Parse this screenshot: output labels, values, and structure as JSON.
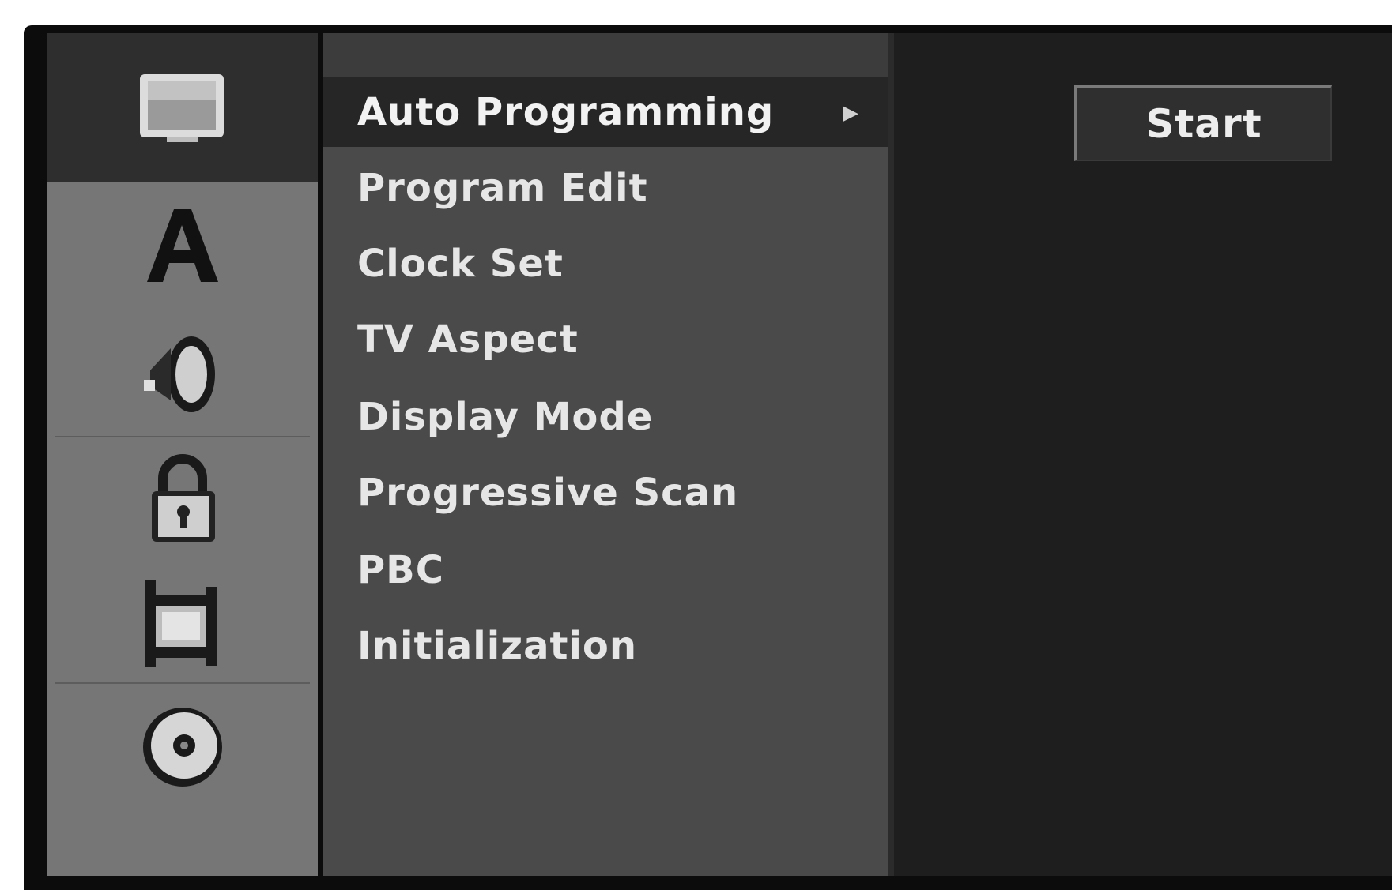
{
  "sidebar": {
    "tabs": [
      {
        "icon": "tv-screen-icon",
        "selected": true
      },
      {
        "icon": "letter-a-language-icon",
        "selected": false
      },
      {
        "icon": "speaker-audio-icon",
        "selected": false
      },
      {
        "icon": "padlock-icon",
        "selected": false
      },
      {
        "icon": "film-strip-icon",
        "selected": false
      },
      {
        "icon": "disc-icon",
        "selected": false
      }
    ]
  },
  "menu": {
    "items": [
      {
        "label": "Auto Programming",
        "selected": true,
        "arrow": "▶"
      },
      {
        "label": "Program Edit"
      },
      {
        "label": "Clock Set"
      },
      {
        "label": "TV Aspect"
      },
      {
        "label": "Display Mode"
      },
      {
        "label": "Progressive Scan"
      },
      {
        "label": "PBC"
      },
      {
        "label": "Initialization"
      }
    ]
  },
  "option_panel": {
    "start_label": "Start"
  },
  "colors": {
    "sidebar": "#767676",
    "sidebar_selected": "#2e2e2e",
    "menu_panel": "#4a4a4a",
    "menu_selected": "#262626",
    "right_panel": "#1e1e1e",
    "text": "#e6e6e6"
  }
}
